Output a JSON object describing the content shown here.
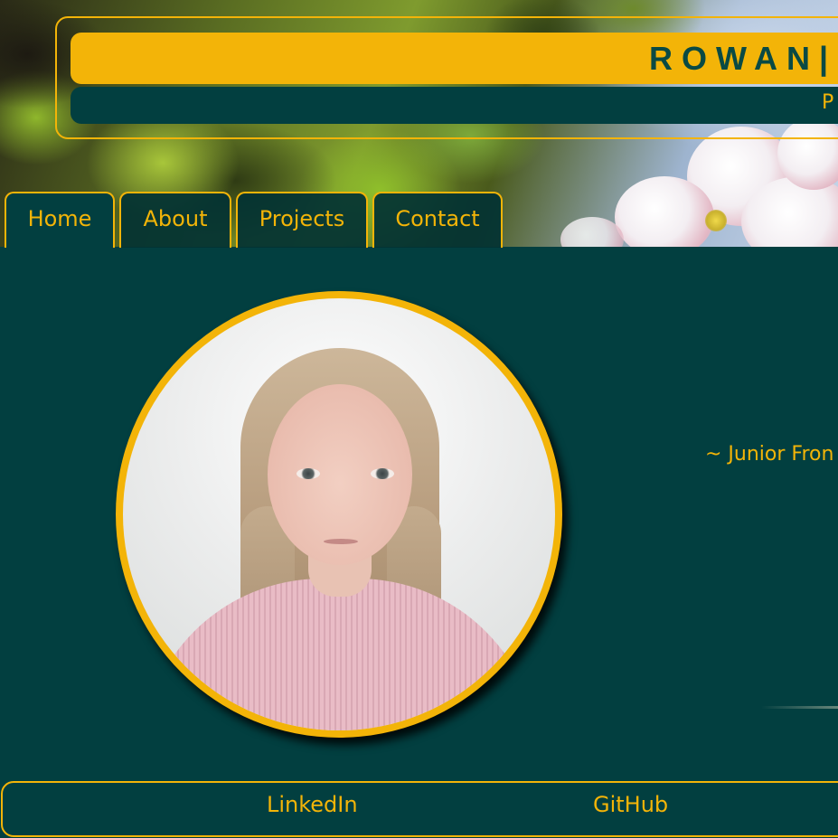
{
  "header": {
    "title": "ROWAN|",
    "subtitle": "P"
  },
  "nav": {
    "tabs": [
      {
        "label": "Home",
        "active": true
      },
      {
        "label": "About",
        "active": false
      },
      {
        "label": "Projects",
        "active": false
      },
      {
        "label": "Contact",
        "active": false
      }
    ]
  },
  "main": {
    "profile_photo_alt": "profile-photo",
    "tagline": "~ Junior Fron"
  },
  "footer": {
    "links": [
      "LinkedIn",
      "GitHub"
    ]
  },
  "colors": {
    "accent": "#f3b408",
    "background": "#023f40"
  }
}
